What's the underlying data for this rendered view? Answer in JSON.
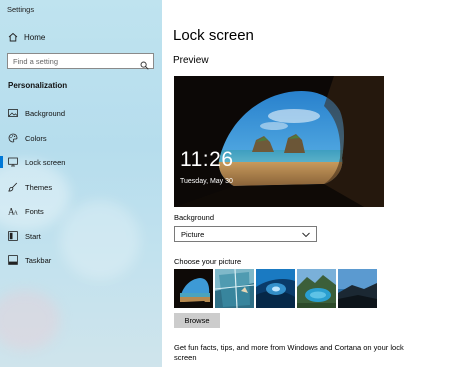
{
  "window": {
    "app_title": "Settings"
  },
  "sidebar": {
    "home_label": "Home",
    "search_placeholder": "Find a setting",
    "section_title": "Personalization",
    "items": [
      {
        "label": "Background",
        "icon": "picture-icon",
        "active": false
      },
      {
        "label": "Colors",
        "icon": "palette-icon",
        "active": false
      },
      {
        "label": "Lock screen",
        "icon": "lock-screen-icon",
        "active": true
      },
      {
        "label": "Themes",
        "icon": "brush-icon",
        "active": false
      },
      {
        "label": "Fonts",
        "icon": "font-icon",
        "active": false
      },
      {
        "label": "Start",
        "icon": "start-icon",
        "active": false
      },
      {
        "label": "Taskbar",
        "icon": "taskbar-icon",
        "active": false
      }
    ]
  },
  "main": {
    "title": "Lock screen",
    "preview_label": "Preview",
    "preview_time": "11:26",
    "preview_date": "Tuesday, May 30",
    "background_label": "Background",
    "background_value": "Picture",
    "choose_label": "Choose your picture",
    "browse_label": "Browse",
    "fun_facts_text": "Get fun facts, tips, and more from Windows and Cortana on your lock screen"
  },
  "colors": {
    "accent": "#0078d7",
    "sidebar_bg": "#bfe3ef",
    "button_bg": "#cccccc"
  }
}
